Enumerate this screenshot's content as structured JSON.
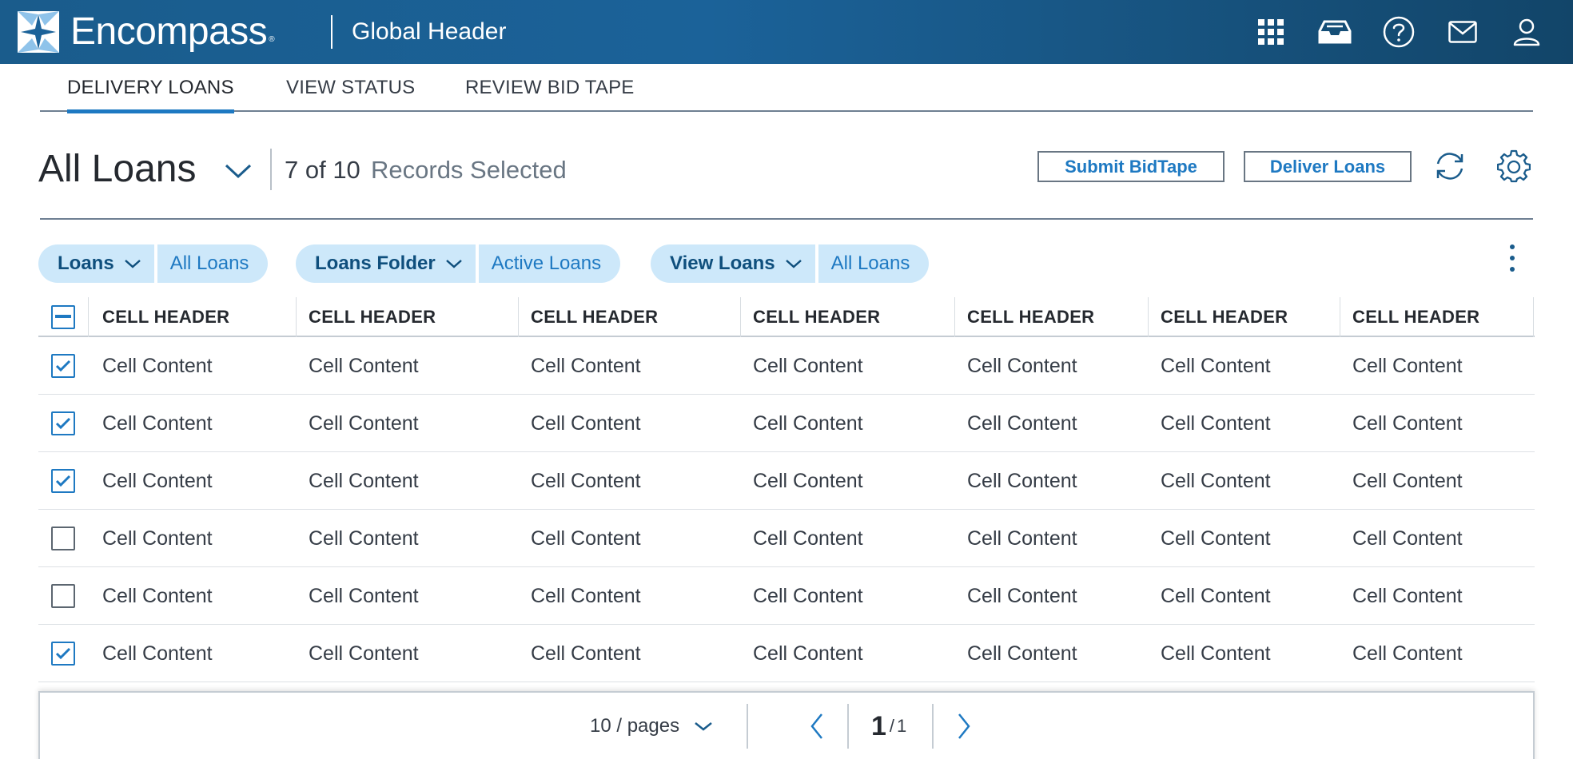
{
  "header": {
    "brand": "Encompass",
    "trademark": "®",
    "title": "Global Header",
    "icons": [
      "apps-grid-icon",
      "inbox-tray-icon",
      "help-icon",
      "mail-icon",
      "user-icon"
    ]
  },
  "tabs": [
    {
      "label": "DELIVERY LOANS",
      "active": true
    },
    {
      "label": "VIEW STATUS",
      "active": false
    },
    {
      "label": "REVIEW BID TAPE",
      "active": false
    }
  ],
  "toolbar": {
    "title": "All Loans",
    "records_count": "7 of 10",
    "records_label": "Records Selected",
    "submit_label": "Submit BidTape",
    "deliver_label": "Deliver Loans"
  },
  "filters": [
    {
      "key": "Loans",
      "value": "All Loans"
    },
    {
      "key": "Loans Folder",
      "value": "Active Loans"
    },
    {
      "key": "View Loans",
      "value": "All Loans"
    }
  ],
  "table": {
    "headers": [
      "CELL HEADER",
      "CELL HEADER",
      "CELL HEADER",
      "CELL HEADER",
      "CELL HEADER",
      "CELL HEADER",
      "CELL HEADER"
    ],
    "rows": [
      {
        "checked": true,
        "cells": [
          "Cell Content",
          "Cell Content",
          "Cell Content",
          "Cell Content",
          "Cell Content",
          "Cell Content",
          "Cell Content"
        ]
      },
      {
        "checked": true,
        "cells": [
          "Cell Content",
          "Cell Content",
          "Cell Content",
          "Cell Content",
          "Cell Content",
          "Cell Content",
          "Cell Content"
        ]
      },
      {
        "checked": true,
        "cells": [
          "Cell Content",
          "Cell Content",
          "Cell Content",
          "Cell Content",
          "Cell Content",
          "Cell Content",
          "Cell Content"
        ]
      },
      {
        "checked": false,
        "cells": [
          "Cell Content",
          "Cell Content",
          "Cell Content",
          "Cell Content",
          "Cell Content",
          "Cell Content",
          "Cell Content"
        ]
      },
      {
        "checked": false,
        "cells": [
          "Cell Content",
          "Cell Content",
          "Cell Content",
          "Cell Content",
          "Cell Content",
          "Cell Content",
          "Cell Content"
        ]
      },
      {
        "checked": true,
        "cells": [
          "Cell Content",
          "Cell Content",
          "Cell Content",
          "Cell Content",
          "Cell Content",
          "Cell Content",
          "Cell Content"
        ]
      }
    ]
  },
  "pagination": {
    "page_size": "10 / pages",
    "current_page": "1",
    "separator": "/",
    "total_pages": "1"
  },
  "colors": {
    "header_bg": "#1a5c8c",
    "accent": "#1e79c2",
    "pill_bg": "#cde8fa"
  }
}
